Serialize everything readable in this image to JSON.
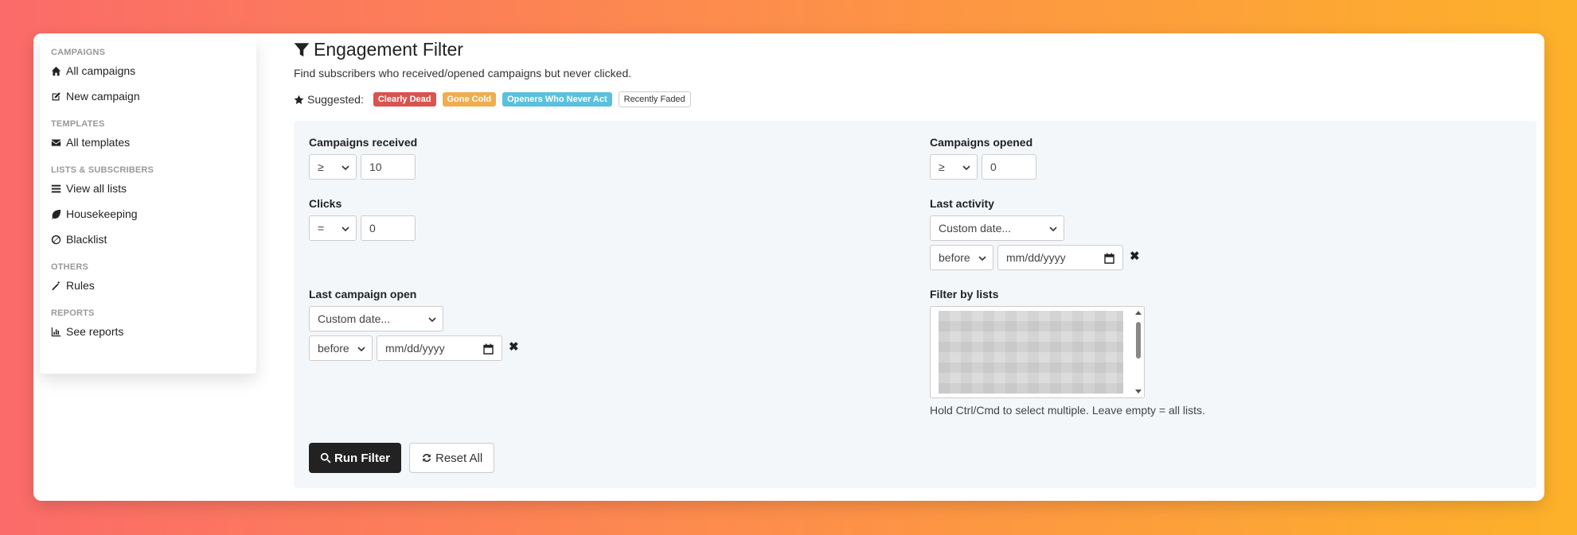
{
  "sidebar": {
    "sections": [
      {
        "header": "CAMPAIGNS",
        "items": [
          {
            "label": "All campaigns",
            "icon": "home-icon"
          },
          {
            "label": "New campaign",
            "icon": "edit-icon"
          }
        ]
      },
      {
        "header": "TEMPLATES",
        "items": [
          {
            "label": "All templates",
            "icon": "envelope-icon"
          }
        ]
      },
      {
        "header": "LISTS & SUBSCRIBERS",
        "items": [
          {
            "label": "View all lists",
            "icon": "list-icon"
          },
          {
            "label": "Housekeeping",
            "icon": "leaf-icon"
          },
          {
            "label": "Blacklist",
            "icon": "ban-icon"
          }
        ]
      },
      {
        "header": "OTHERS",
        "items": [
          {
            "label": "Rules",
            "icon": "magic-wand-icon"
          }
        ]
      },
      {
        "header": "REPORTS",
        "items": [
          {
            "label": "See reports",
            "icon": "bar-chart-icon"
          }
        ]
      }
    ]
  },
  "main": {
    "title": "Engagement Filter",
    "subtitle": "Find subscribers who received/opened campaigns but never clicked.",
    "suggested_label": "Suggested:",
    "suggested": [
      {
        "label": "Clearly Dead",
        "color": "#d9534f"
      },
      {
        "label": "Gone Cold",
        "color": "#f0ad4e"
      },
      {
        "label": "Openers Who Never Act",
        "color": "#5bc0de"
      },
      {
        "label": "Recently Faded",
        "color": "#ffffff"
      }
    ]
  },
  "filters": {
    "received": {
      "label": "Campaigns received",
      "operator": "≥",
      "value": "10"
    },
    "opened": {
      "label": "Campaigns opened",
      "operator": "≥",
      "value": "0"
    },
    "clicks": {
      "label": "Clicks",
      "operator": "=",
      "value": "0"
    },
    "last_activity": {
      "label": "Last activity",
      "mode": "Custom date...",
      "relation": "before",
      "date_placeholder": "mm/dd/yyyy"
    },
    "last_open": {
      "label": "Last campaign open",
      "mode": "Custom date...",
      "relation": "before",
      "date_placeholder": "mm/dd/yyyy"
    },
    "lists": {
      "label": "Filter by lists",
      "help": "Hold Ctrl/Cmd to select multiple. Leave empty = all lists."
    }
  },
  "actions": {
    "run": "Run Filter",
    "reset": "Reset All"
  }
}
